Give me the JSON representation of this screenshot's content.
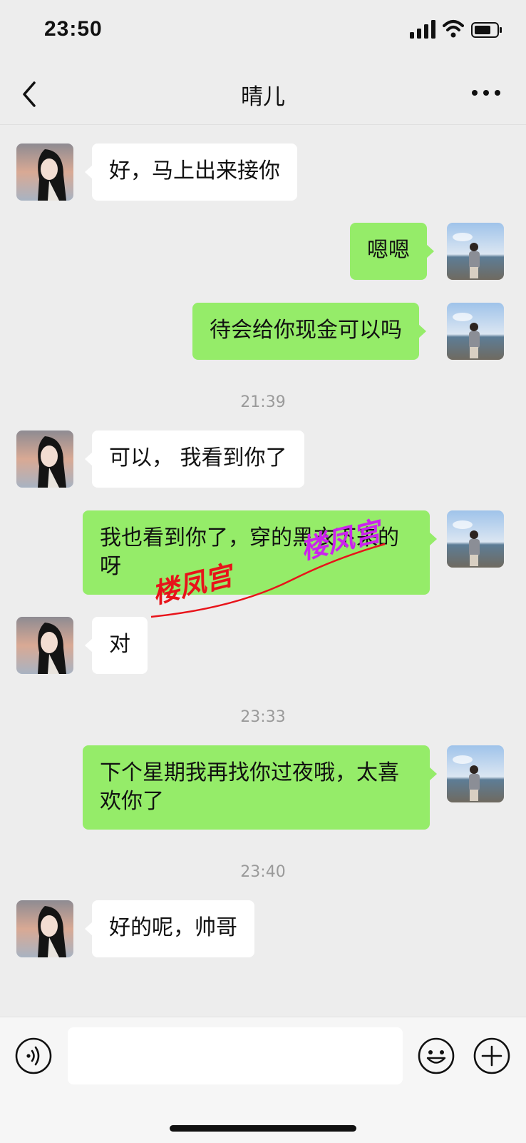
{
  "status_bar": {
    "time": "23:50"
  },
  "header": {
    "title": "晴儿"
  },
  "messages": [
    {
      "side": "in",
      "text": "好，马上出来接你"
    },
    {
      "side": "out",
      "text": "嗯嗯"
    },
    {
      "side": "out",
      "text": "待会给你现金可以吗"
    },
    {
      "side": "time",
      "text": "21:39"
    },
    {
      "side": "in",
      "text": "可以， 我看到你了"
    },
    {
      "side": "out",
      "text": "我也看到你了，穿的黑衣下来的呀"
    },
    {
      "side": "in",
      "text": "对"
    },
    {
      "side": "time",
      "text": "23:33"
    },
    {
      "side": "out",
      "text": "下个星期我再找你过夜哦，太喜欢你了"
    },
    {
      "side": "time",
      "text": "23:40"
    },
    {
      "side": "in",
      "text": "好的呢，帅哥"
    }
  ],
  "watermark": {
    "text": "楼凤宫"
  },
  "input": {
    "value": ""
  },
  "colors": {
    "background": "#ededed",
    "outgoing_bubble": "#95ec69",
    "incoming_bubble": "#ffffff"
  },
  "icons": [
    "back-icon",
    "more-icon",
    "voice-icon",
    "emoji-icon",
    "plus-icon",
    "signal-icon",
    "wifi-icon",
    "battery-icon"
  ]
}
